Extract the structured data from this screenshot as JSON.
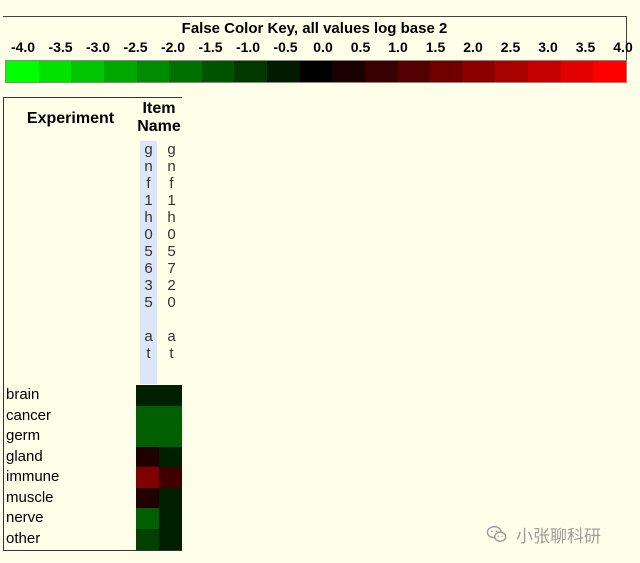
{
  "chart_data": {
    "type": "heatmap",
    "title": "False Color Key, all values log base 2",
    "key_ticks": [
      "-4.0",
      "-3.5",
      "-3.0",
      "-2.5",
      "-2.0",
      "-1.5",
      "-1.0",
      "-0.5",
      "0.0",
      "0.5",
      "1.0",
      "1.5",
      "2.0",
      "2.5",
      "3.0",
      "3.5",
      "4.0"
    ],
    "key_colors": [
      "#00FF00",
      "#00E200",
      "#00C500",
      "#00A900",
      "#008C00",
      "#007000",
      "#005400",
      "#003800",
      "#001B00",
      "#000000",
      "#1B0000",
      "#380000",
      "#540000",
      "#700000",
      "#8C0000",
      "#A90000",
      "#C50000",
      "#E20000",
      "#FF0000"
    ],
    "row_header": "Experiment",
    "col_header": "Item Name",
    "columns": [
      "gnf1h05635at",
      "gnf1h05720at"
    ],
    "rows": [
      "brain",
      "cancer",
      "germ",
      "gland",
      "immune",
      "muscle",
      "nerve",
      "other"
    ],
    "values": [
      [
        -0.5,
        -0.5
      ],
      [
        -1.5,
        -1.5
      ],
      [
        -1.5,
        -1.5
      ],
      [
        0.5,
        -0.5
      ],
      [
        2.0,
        1.0
      ],
      [
        0.5,
        -0.5
      ],
      [
        -1.5,
        -0.5
      ],
      [
        -1.0,
        -0.5
      ]
    ]
  },
  "watermark": {
    "text": "小张聊科研",
    "icon": "wechat-icon"
  }
}
